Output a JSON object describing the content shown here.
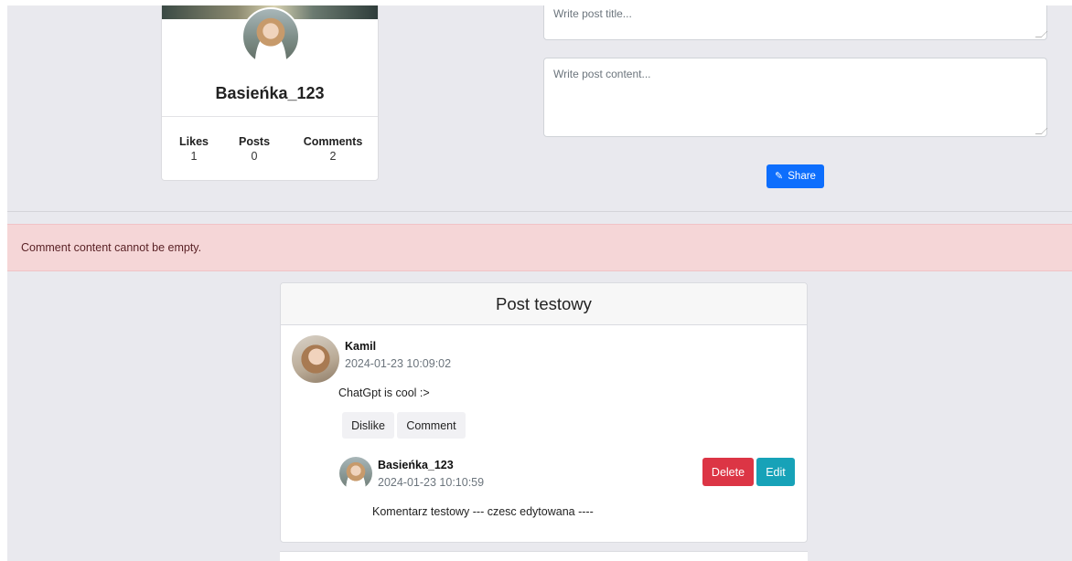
{
  "profile": {
    "username": "Basieńka_123",
    "stats": [
      {
        "label": "Likes",
        "value": "1"
      },
      {
        "label": "Posts",
        "value": "0"
      },
      {
        "label": "Comments",
        "value": "2"
      }
    ]
  },
  "new_post": {
    "title_placeholder": "Write post title...",
    "content_placeholder": "Write post content...",
    "share_label": "Share",
    "share_icon": "pencil-icon"
  },
  "alert": {
    "message": "Comment content cannot be empty."
  },
  "post": {
    "title": "Post testowy",
    "author": "Kamil",
    "timestamp": "2024-01-23 10:09:02",
    "content": "ChatGpt is cool :>",
    "dislike_label": "Dislike",
    "comment_label": "Comment",
    "comments": [
      {
        "author": "Basieńka_123",
        "timestamp": "2024-01-23 10:10:59",
        "content": "Komentarz testowy --- czesc edytowana ----",
        "delete_label": "Delete",
        "edit_label": "Edit"
      }
    ]
  },
  "colors": {
    "background": "#e9e9ee",
    "primary": "#0d6efd",
    "danger": "#dc3545",
    "info": "#17a2b8",
    "alert_bg": "#f5d6d7"
  }
}
